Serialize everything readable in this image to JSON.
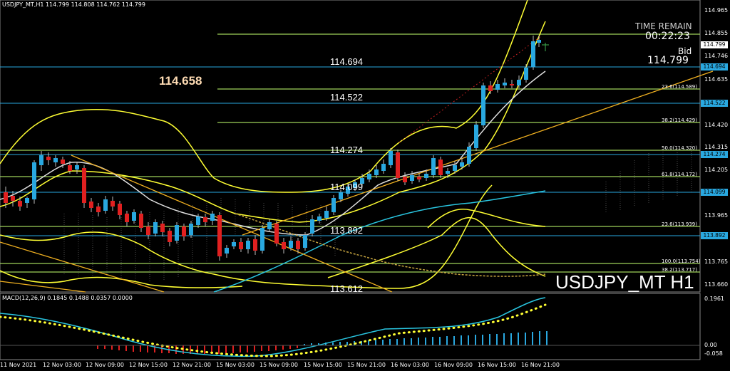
{
  "header": {
    "symbol_info": "USDJPY_MT,H1  114.799 114.808 114.762 114.799"
  },
  "macd": {
    "label": "MACD(12,26,9) 0.1845 0.1488 0.0357 0.0000"
  },
  "level_labels": [
    "114.694",
    "114.522",
    "114.274",
    "114.099",
    "113.892",
    "113.612"
  ],
  "highlight_price": "114.658",
  "symbol_watermark": "USDJPY_MT H1",
  "time_remain": {
    "label": "TIME REMAIN",
    "value": "00:22:23"
  },
  "bid": {
    "label": "Bid",
    "value": "114.799"
  },
  "fib_labels": [
    "23.6(114.589)",
    "38.2(114.429)",
    "50.0(114.320)",
    "61.8(114.172)",
    "23.6(113.939)",
    "100.0(113.754)",
    "38.2(113.717)"
  ],
  "price_axis": [
    "114.965",
    "114.855",
    "114.746",
    "114.635",
    "114.420",
    "114.315",
    "114.205",
    "113.965",
    "113.765",
    "113.660"
  ],
  "price_tags": {
    "current": "114.799",
    "blue": [
      "114.694",
      "114.522",
      "114.274",
      "114.099",
      "113.892"
    ]
  },
  "macd_axis": [
    "0.1961",
    "0.00",
    "-0.058"
  ],
  "time_axis": [
    "11 Nov 2021",
    "12 Nov 03:00",
    "12 Nov 09:00",
    "12 Nov 15:00",
    "12 Nov 21:00",
    "15 Nov 03:00",
    "15 Nov 09:00",
    "15 Nov 15:00",
    "15 Nov 21:00",
    "16 Nov 03:00",
    "16 Nov 09:00",
    "16 Nov 15:00",
    "16 Nov 21:00"
  ],
  "colors": {
    "bull": "#29a8e0",
    "bear": "#e02020",
    "bands": "#ffff33",
    "fib": "#9ed15a",
    "level": "#29a8e0"
  }
}
